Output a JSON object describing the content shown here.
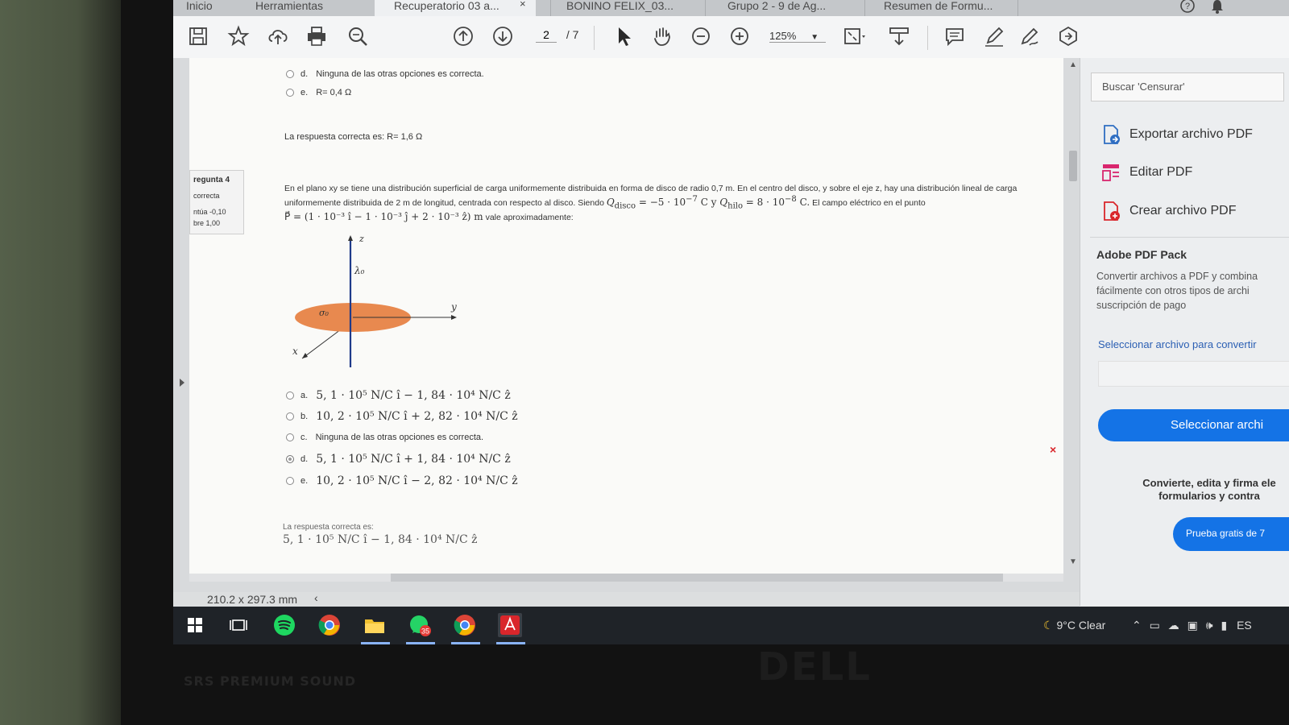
{
  "tabs": [
    {
      "label": "Inicio"
    },
    {
      "label": "Herramientas"
    },
    {
      "label": "Recuperatorio 03 a..."
    },
    {
      "label": "BONINO FELIX_03..."
    },
    {
      "label": "Grupo 2 - 9 de Ag..."
    },
    {
      "label": "Resumen de Formu..."
    }
  ],
  "toolbar": {
    "page_current": "2",
    "page_total": "/ 7",
    "zoom": "125%",
    "icons": [
      "save-icon",
      "star-icon",
      "upload-icon",
      "print-icon",
      "zoom-search-icon",
      "page-up-icon",
      "page-down-icon",
      "select-cursor-icon",
      "hand-icon",
      "zoom-out-icon",
      "zoom-in-icon",
      "fit-page-icon",
      "scroll-mode-icon",
      "comment-icon",
      "highlight-icon",
      "sign-icon",
      "share-icon"
    ]
  },
  "document": {
    "prev_question": {
      "opt_d_letter": "d.",
      "opt_d_text": "Ninguna de las otras opciones es correcta.",
      "opt_e_letter": "e.",
      "opt_e_text": "R= 0,4 Ω",
      "answer": "La respuesta correcta es: R= 1,6 Ω"
    },
    "info": {
      "pregunta": "regunta 4",
      "estado": "correcta",
      "puntua": "ntúa -0,10",
      "sobre": "bre 1,00"
    },
    "question": {
      "line1": "En el plano xy se tiene una distribución superficial de carga uniformemente distribuida en forma de disco de radio 0,7 m. En el centro del disco, y sobre el eje z, hay una distribución lineal de carga",
      "line2a": "uniformemente distribuida de 2 m de longitud, centrada con respecto al disco. Siendo",
      "q_disco": "Q",
      "q_disco_sub": "disco",
      "q_disco_val": " = −5 · 10",
      "q_disco_exp": "−7",
      "q_disco_unit": " C y ",
      "q_hilo": "Q",
      "q_hilo_sub": "hilo",
      "q_hilo_val": " = 8 · 10",
      "q_hilo_exp": "−8",
      "q_hilo_unit": " C.",
      "line2b": " El campo eléctrico en el punto",
      "point": "P⃗ = (1 · 10⁻³ î − 1 · 10⁻³ ĵ + 2 · 10⁻³ ẑ) m",
      "line3": " vale aproximadamente:"
    },
    "figure": {
      "z_label": "z",
      "y_label": "y",
      "x_label": "x",
      "lambda_label": "λ₀",
      "sigma_label": "σ₀"
    },
    "options": [
      {
        "letter": "a.",
        "text": "5, 1 · 10⁵ N/C î − 1, 84 · 10⁴ N/C ẑ",
        "selected": false
      },
      {
        "letter": "b.",
        "text": "10, 2 · 10⁵ N/C î + 2, 82 · 10⁴ N/C ẑ",
        "selected": false
      },
      {
        "letter": "c.",
        "text": "Ninguna de las otras opciones es correcta.",
        "selected": false
      },
      {
        "letter": "d.",
        "text": "5, 1 · 10⁵ N/C î + 1, 84 · 10⁴ N/C ẑ",
        "selected": true
      },
      {
        "letter": "e.",
        "text": "10, 2 · 10⁵ N/C î − 2, 82 · 10⁴ N/C ẑ",
        "selected": false
      }
    ],
    "wrong_mark": "×",
    "answer_label": "La respuesta correcta es:",
    "answer_value": "5, 1 · 10⁵ N/C î − 1, 84 · 10⁴ N/C ẑ"
  },
  "status": {
    "page_size": "210.2 x 297.3 mm"
  },
  "right_pane": {
    "search_placeholder": "Buscar 'Censurar'",
    "tools": [
      {
        "label": "Exportar archivo PDF",
        "icon": "export-pdf-icon"
      },
      {
        "label": "Editar PDF",
        "icon": "edit-pdf-icon"
      },
      {
        "label": "Crear archivo PDF",
        "icon": "create-pdf-icon"
      }
    ],
    "pack_title": "Adobe PDF Pack",
    "pack_text": "Convertir archivos a PDF y combina fácilmente con otros tipos de archi suscripción de pago",
    "select_link": "Seleccionar archivo para convertir",
    "select_button": "Seleccionar archi",
    "promo_line1": "Convierte, edita y firma ele",
    "promo_line2": "formularios y contra",
    "trial_button": "Prueba gratis de 7"
  },
  "taskbar": {
    "weather": "9°C  Clear",
    "lang": "ES",
    "badge": "35"
  },
  "bezel": {
    "brand": "SRS PREMIUM SOUND",
    "logo": "DELL"
  },
  "colors": {
    "disc": "#e8894f",
    "accent": "#1473e6",
    "wrong": "#d9262b"
  }
}
